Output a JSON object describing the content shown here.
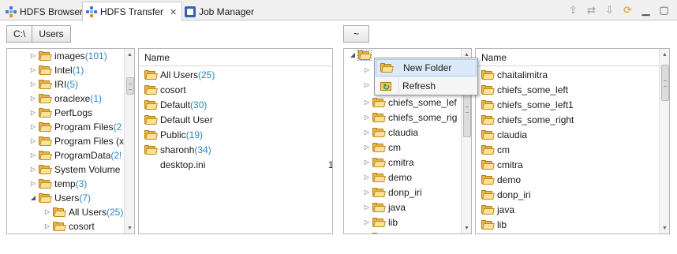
{
  "tabs": [
    {
      "label": "HDFS Browser",
      "active": false
    },
    {
      "label": "HDFS Transfer",
      "active": true,
      "close": "✕"
    },
    {
      "label": "Job Manager",
      "active": false
    }
  ],
  "toolbar_icons": [
    "toolbar-icon-1",
    "toolbar-icon-2",
    "toolbar-icon-3",
    "toolbar-icon-4",
    "minimize-icon",
    "maximize-icon"
  ],
  "local": {
    "path": [
      "C:\\",
      "Users"
    ],
    "tree": [
      {
        "name": "images",
        "count": "(101)",
        "expanded": false
      },
      {
        "name": "Intel",
        "count": "(1)",
        "expanded": false
      },
      {
        "name": "IRI",
        "count": "(5)",
        "expanded": false
      },
      {
        "name": "oraclexe",
        "count": "(1)",
        "expanded": false
      },
      {
        "name": "PerfLogs",
        "count": "",
        "expanded": false
      },
      {
        "name": "Program Files",
        "count": "(2",
        "expanded": false
      },
      {
        "name": "Program Files (x",
        "count": "",
        "expanded": false
      },
      {
        "name": "ProgramData",
        "count": "(2!",
        "expanded": false
      },
      {
        "name": "System Volume",
        "count": "",
        "expanded": false
      },
      {
        "name": "temp",
        "count": "(3)",
        "expanded": false
      },
      {
        "name": "Users",
        "count": "(7)",
        "expanded": true
      },
      {
        "name": "All Users",
        "count": "(25)",
        "expanded": false,
        "child": true
      },
      {
        "name": "cosort",
        "count": "",
        "expanded": false,
        "child": true
      }
    ],
    "list_header": "Name",
    "list": [
      {
        "name": "All Users",
        "count": "(25)",
        "type": "folder"
      },
      {
        "name": "cosort",
        "count": "",
        "type": "folder"
      },
      {
        "name": "Default",
        "count": "(30)",
        "type": "folder"
      },
      {
        "name": "Default User",
        "count": "",
        "type": "folder"
      },
      {
        "name": "Public",
        "count": "(19)",
        "type": "folder"
      },
      {
        "name": "sharonh",
        "count": "(34)",
        "type": "folder"
      },
      {
        "name": "desktop.ini",
        "count": "",
        "type": "file",
        "size": "1"
      }
    ]
  },
  "remote": {
    "path": [
      "~"
    ],
    "tree": [
      {
        "name": "chiefs_some_left",
        "visible": "chiefs_some_lef"
      },
      {
        "name": "chiefs_some_right",
        "visible": "chiefs_some_rig"
      },
      {
        "name": "claudia",
        "visible": "claudia"
      },
      {
        "name": "cm",
        "visible": "cm"
      },
      {
        "name": "cmitra",
        "visible": "cmitra"
      },
      {
        "name": "demo",
        "visible": "demo"
      },
      {
        "name": "donp_iri",
        "visible": "donp_iri"
      },
      {
        "name": "java",
        "visible": "java"
      },
      {
        "name": "lib",
        "visible": "lib"
      },
      {
        "name": "newyorkers.out",
        "visible": "newyorkers.out"
      }
    ],
    "list_header": "Name",
    "list": [
      "chaitalimitra",
      "chiefs_some_left",
      "chiefs_some_left1",
      "chiefs_some_right",
      "claudia",
      "cm",
      "cmitra",
      "demo",
      "donp_iri",
      "java",
      "lib"
    ]
  },
  "context_menu": {
    "items": [
      {
        "label": "New Folder",
        "highlighted": true
      },
      {
        "label": "Refresh",
        "highlighted": false
      }
    ]
  },
  "colors": {
    "count": "#2e86c1",
    "folder": "#e8b44a",
    "highlight": "#dbe9f8"
  }
}
